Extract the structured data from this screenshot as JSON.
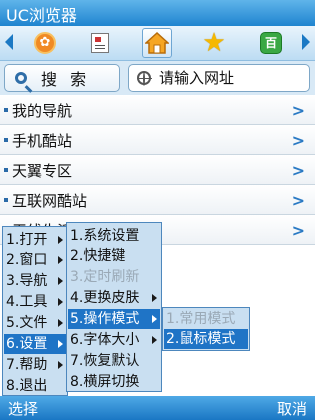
{
  "app": {
    "title": "UC浏览器"
  },
  "toolbar": {
    "icons": [
      "uc-logo-icon",
      "news-icon",
      "home-icon",
      "star-icon",
      "baidu-100-icon"
    ],
    "baidu_glyph": "百"
  },
  "search": {
    "button_label": "搜 索",
    "url_placeholder": "请输入网址"
  },
  "nav_list": [
    {
      "label": "我的导航"
    },
    {
      "label": "手机酷站"
    },
    {
      "label": "天翼专区"
    },
    {
      "label": "互联网酷站"
    },
    {
      "label": "无线生活"
    }
  ],
  "menu_main": [
    {
      "label": "1.打开"
    },
    {
      "label": "2.窗口"
    },
    {
      "label": "3.导航"
    },
    {
      "label": "4.工具"
    },
    {
      "label": "5.文件"
    },
    {
      "label": "6.设置"
    },
    {
      "label": "7.帮助"
    },
    {
      "label": "8.退出"
    }
  ],
  "menu_settings": [
    {
      "label": "1.系统设置"
    },
    {
      "label": "2.快捷键"
    },
    {
      "label": "3.定时刷新"
    },
    {
      "label": "4.更换皮肤"
    },
    {
      "label": "5.操作模式"
    },
    {
      "label": "6.字体大小"
    },
    {
      "label": "7.恢复默认"
    },
    {
      "label": "8.横屏切换"
    }
  ],
  "menu_mode": [
    {
      "label": "1.常用模式"
    },
    {
      "label": "2.鼠标模式"
    }
  ],
  "softkeys": {
    "left": "选择",
    "right": "取消"
  },
  "colors": {
    "accent": "#1f74c6",
    "title_bar": "#1f84cf",
    "menu_bg": "#c9dff1"
  }
}
